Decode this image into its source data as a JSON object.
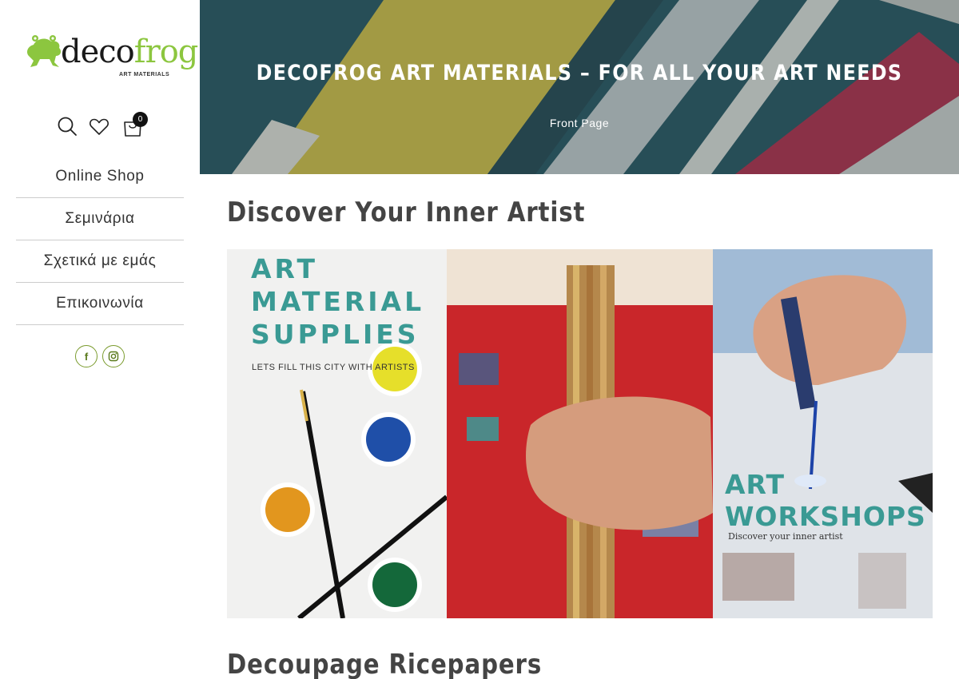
{
  "brand": {
    "logo_part1": "deco",
    "logo_part2": "frog",
    "logo_tagline": "ART MATERIALS",
    "accent_color": "#8cc63f"
  },
  "header_icons": {
    "search": "search-icon",
    "wishlist": "heart-icon",
    "cart": "shopping-bag-icon",
    "cart_count": "0"
  },
  "nav": {
    "items": [
      {
        "label": "Online Shop"
      },
      {
        "label": "Σεμινάρια"
      },
      {
        "label": "Σχετικά με εμάς"
      },
      {
        "label": "Επικοινωνία"
      }
    ]
  },
  "social": {
    "facebook_glyph": "f",
    "instagram_icon": "instagram-icon"
  },
  "hero": {
    "title": "DECOFROG ART MATERIALS – FOR ALL YOUR ART NEEDS",
    "breadcrumb": "Front Page"
  },
  "sections": {
    "discover_title": "Discover Your Inner Artist",
    "decoupage_title": "Decoupage Ricepapers"
  },
  "banner": {
    "left_heading_line1": "ART",
    "left_heading_line2": "MATERIAL",
    "left_heading_line3": "SUPPLIES",
    "left_subtitle": "LETS FILL THIS CITY WITH ARTISTS",
    "right_heading_line1": "ART",
    "right_heading_line2": "WORKSHOPS",
    "right_subtitle": "Discover your inner artist"
  }
}
